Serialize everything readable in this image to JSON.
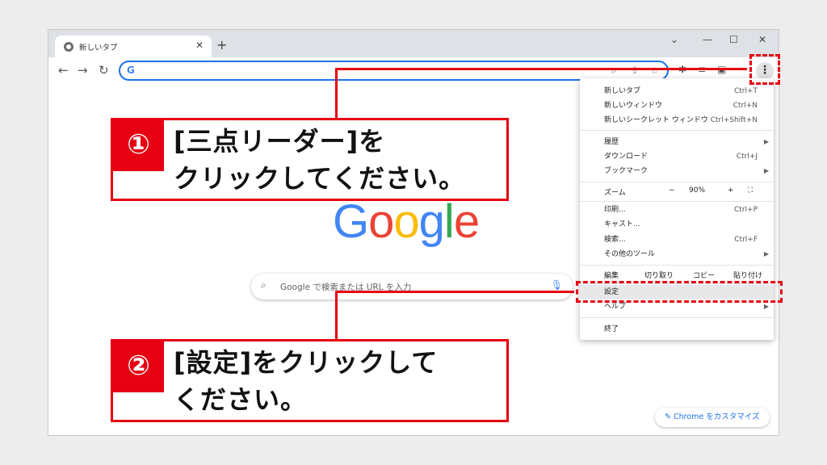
{
  "tab": {
    "title": "新しいタブ",
    "close": "✕",
    "new": "+"
  },
  "window_controls": {
    "minimize": "—",
    "maximize": "☐",
    "close": "✕",
    "dropdown": "⌄"
  },
  "nav": {
    "back": "←",
    "forward": "→",
    "reload": "↻"
  },
  "omnibox": {
    "value": "",
    "google_g": "G"
  },
  "logo": {
    "text": "Google"
  },
  "search": {
    "placeholder": "Google で検索または URL を入力"
  },
  "customize": {
    "label": "Chrome をカスタマイズ"
  },
  "menu": {
    "new_tab": {
      "label": "新しいタブ",
      "shortcut": "Ctrl+T"
    },
    "new_window": {
      "label": "新しいウィンドウ",
      "shortcut": "Ctrl+N"
    },
    "incognito": {
      "label": "新しいシークレット ウィンドウ",
      "shortcut": "Ctrl+Shift+N"
    },
    "history": {
      "label": "履歴"
    },
    "downloads": {
      "label": "ダウンロード",
      "shortcut": "Ctrl+J"
    },
    "bookmarks": {
      "label": "ブックマーク"
    },
    "zoom": {
      "label": "ズーム",
      "minus": "−",
      "value": "90%",
      "plus": "+"
    },
    "print": {
      "label": "印刷...",
      "shortcut": "Ctrl+P"
    },
    "cast": {
      "label": "キャスト..."
    },
    "find": {
      "label": "検索...",
      "shortcut": "Ctrl+F"
    },
    "more_tools": {
      "label": "その他のツール"
    },
    "edit": {
      "label": "編集",
      "cut": "切り取り",
      "copy": "コピー",
      "paste": "貼り付け"
    },
    "settings": {
      "label": "設定"
    },
    "help": {
      "label": "ヘルプ"
    },
    "exit": {
      "label": "終了"
    }
  },
  "callout1": {
    "num": "①",
    "line1": "[三点リーダー]を",
    "line2": "クリックしてください。"
  },
  "callout2": {
    "num": "②",
    "line1": "[設定]をクリックして",
    "line2": "ください。"
  },
  "colors": {
    "accent_red": "#e60012",
    "chrome_blue": "#1a73e8"
  }
}
